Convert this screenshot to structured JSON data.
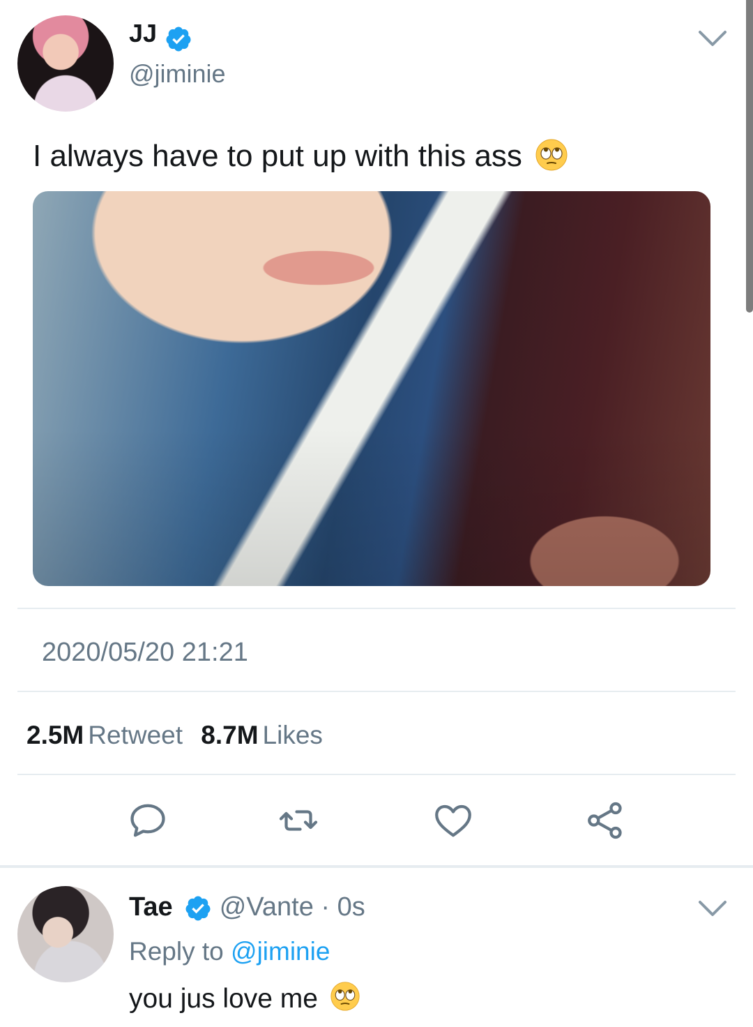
{
  "main_tweet": {
    "author_name": "JJ",
    "author_handle": "@jiminie",
    "verified": true,
    "text": "I always have to put up with this ass",
    "emoji": "face-with-rolling-eyes",
    "timestamp": "2020/05/20 21:21",
    "retweet_count": "2.5M",
    "retweet_label": "Retweet",
    "like_count": "8.7M",
    "like_label": "Likes",
    "actions": [
      "reply-icon",
      "retweet-icon",
      "like-icon",
      "share-icon"
    ]
  },
  "reply": {
    "author_name": "Tae",
    "verified": true,
    "handle_time": "@Vante · 0s",
    "reply_to_label": "Reply to",
    "reply_to_handle": "@jiminie",
    "text": "you jus love me",
    "emoji": "face-with-rolling-eyes"
  },
  "colors": {
    "accent": "#1da1f2",
    "secondary_text": "#657786",
    "primary_text": "#14171a",
    "divider": "#e6ecf0"
  }
}
